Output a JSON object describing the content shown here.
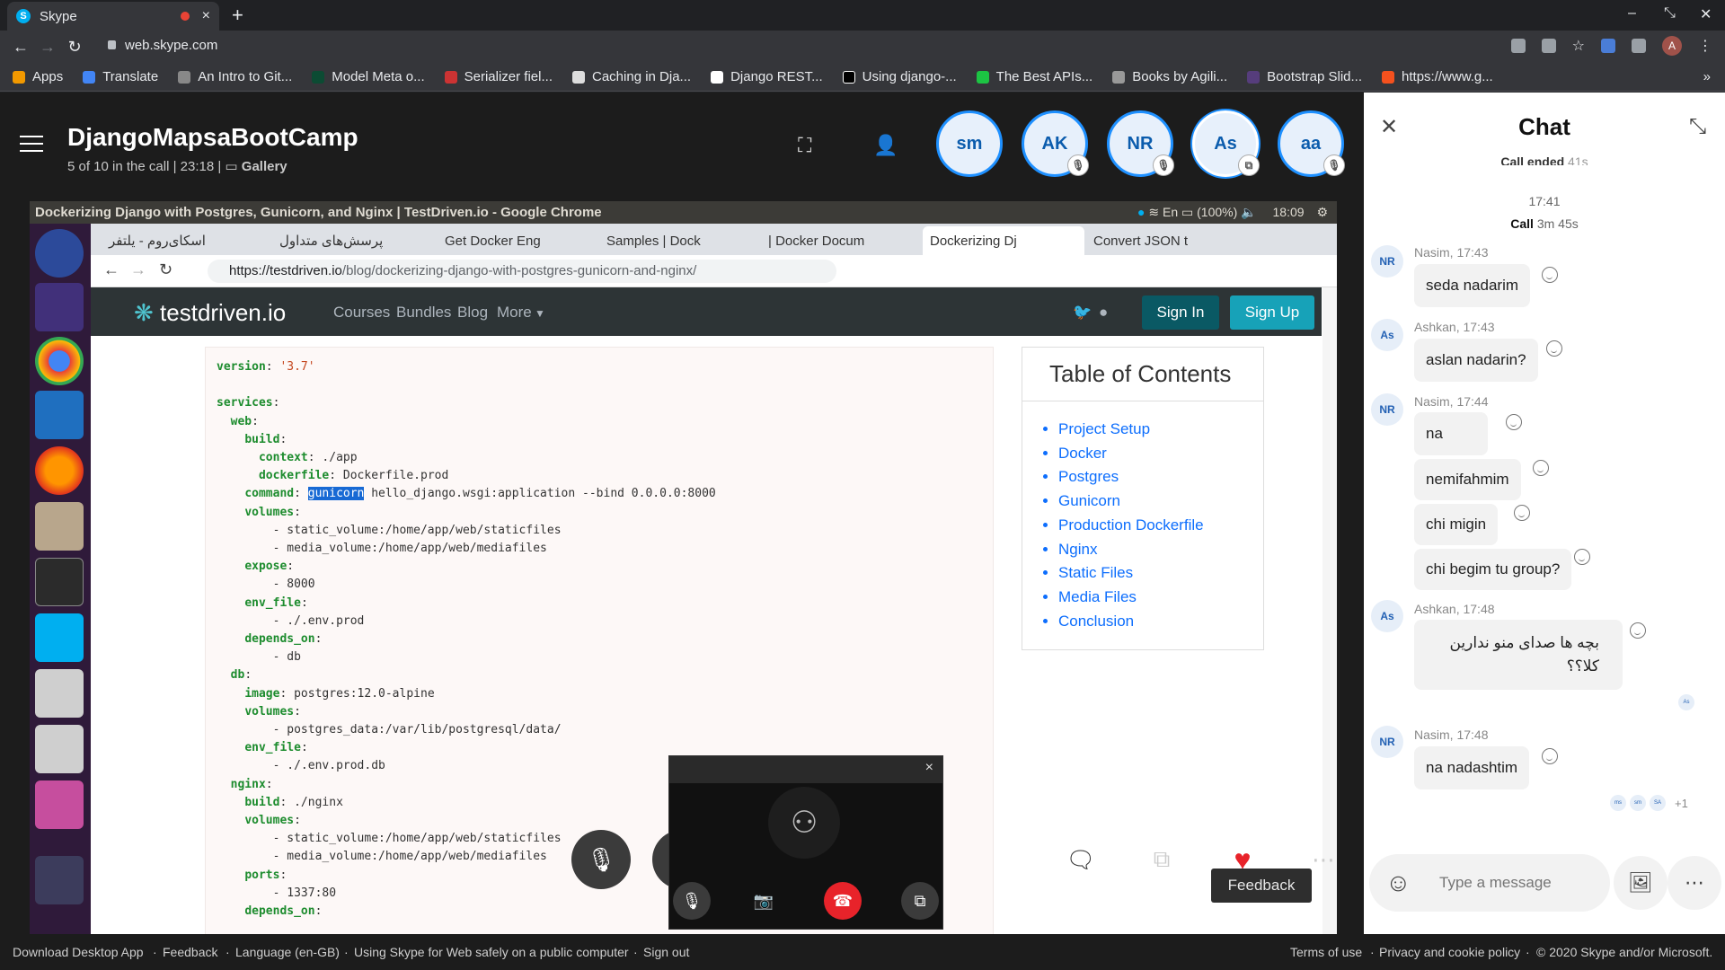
{
  "browser": {
    "tab_title": "Skype",
    "url": "web.skype.com",
    "bookmarks": [
      "Apps",
      "Translate",
      "An Intro to Git...",
      "Model Meta o...",
      "Serializer fiel...",
      "Caching in Dja...",
      "Django REST...",
      "Using django-...",
      "The Best APIs...",
      "Books by Agili...",
      "Bootstrap Slid...",
      "https://www.g..."
    ],
    "profile_initial": "A"
  },
  "call": {
    "title": "DjangoMapsaBootCamp",
    "subtitle": "5 of 10 in the call | 23:18 |",
    "view_mode": "Gallery",
    "participants": [
      "sm",
      "AK",
      "NR",
      "As",
      "aa"
    ],
    "feedback_label": "Feedback"
  },
  "shared_screen": {
    "window_title": "Dockerizing Django with Postgres, Gunicorn, and Nginx | TestDriven.io - Google Chrome",
    "status": {
      "lang": "En",
      "battery": "(100%)",
      "time": "18:09"
    },
    "tabs": [
      "اسکای‌روم - یلتفر",
      "پرسش‌های متداول",
      "Get Docker Eng",
      "Samples | Dock",
      "| Docker Docum",
      "Dockerizing Dj",
      "Convert JSON t"
    ],
    "url_host": "https://testdriven.io",
    "url_path": "/blog/dockerizing-django-with-postgres-gunicorn-and-nginx/",
    "site": {
      "logo": "testdriven.io",
      "nav": [
        "Courses",
        "Bundles",
        "Blog",
        "More"
      ],
      "sign_in": "Sign In",
      "sign_up": "Sign Up"
    },
    "code_lines": [
      {
        "indent": "",
        "key": "version",
        "rest": "",
        "str": "'3.7'"
      },
      {
        "indent": "",
        "key": "",
        "rest": "",
        "str": ""
      },
      {
        "indent": "",
        "key": "services",
        "rest": "",
        "str": ""
      },
      {
        "indent": "  ",
        "key": "web",
        "rest": "",
        "str": ""
      },
      {
        "indent": "    ",
        "key": "build",
        "rest": "",
        "str": ""
      },
      {
        "indent": "      ",
        "key": "context",
        "rest": "./app",
        "str": ""
      },
      {
        "indent": "      ",
        "key": "dockerfile",
        "rest": "Dockerfile.prod",
        "str": ""
      },
      {
        "indent": "    ",
        "key": "command",
        "hl": "gunicorn",
        "rest": "hello_django.wsgi:application --bind 0.0.0.0:8000",
        "str": ""
      },
      {
        "indent": "    ",
        "key": "volumes",
        "rest": "",
        "str": ""
      },
      {
        "indent": "      ",
        "key": "",
        "rest": "- static_volume:/home/app/web/staticfiles",
        "str": ""
      },
      {
        "indent": "      ",
        "key": "",
        "rest": "- media_volume:/home/app/web/mediafiles",
        "str": ""
      },
      {
        "indent": "    ",
        "key": "expose",
        "rest": "",
        "str": ""
      },
      {
        "indent": "      ",
        "key": "",
        "rest": "- 8000",
        "str": ""
      },
      {
        "indent": "    ",
        "key": "env_file",
        "rest": "",
        "str": ""
      },
      {
        "indent": "      ",
        "key": "",
        "rest": "- ./.env.prod",
        "str": ""
      },
      {
        "indent": "    ",
        "key": "depends_on",
        "rest": "",
        "str": ""
      },
      {
        "indent": "      ",
        "key": "",
        "rest": "- db",
        "str": ""
      },
      {
        "indent": "  ",
        "key": "db",
        "rest": "",
        "str": ""
      },
      {
        "indent": "    ",
        "key": "image",
        "rest": "postgres:12.0-alpine",
        "str": ""
      },
      {
        "indent": "    ",
        "key": "volumes",
        "rest": "",
        "str": ""
      },
      {
        "indent": "      ",
        "key": "",
        "rest": "- postgres_data:/var/lib/postgresql/data/",
        "str": ""
      },
      {
        "indent": "    ",
        "key": "env_file",
        "rest": "",
        "str": ""
      },
      {
        "indent": "      ",
        "key": "",
        "rest": "- ./.env.prod.db",
        "str": ""
      },
      {
        "indent": "  ",
        "key": "nginx",
        "rest": "",
        "str": ""
      },
      {
        "indent": "    ",
        "key": "build",
        "rest": "./nginx",
        "str": ""
      },
      {
        "indent": "    ",
        "key": "volumes",
        "rest": "",
        "str": ""
      },
      {
        "indent": "      ",
        "key": "",
        "rest": "- static_volume:/home/app/web/staticfiles",
        "str": ""
      },
      {
        "indent": "      ",
        "key": "",
        "rest": "- media_volume:/home/app/web/mediafiles",
        "str": ""
      },
      {
        "indent": "    ",
        "key": "ports",
        "rest": "",
        "str": ""
      },
      {
        "indent": "      ",
        "key": "",
        "rest": "- 1337:80",
        "str": ""
      },
      {
        "indent": "    ",
        "key": "depends_on",
        "rest": "",
        "str": ""
      }
    ],
    "toc": {
      "title": "Table of Contents",
      "items": [
        "Project Setup",
        "Docker",
        "Postgres",
        "Gunicorn",
        "Production Dockerfile",
        "Nginx",
        "Static Files",
        "Media Files",
        "Conclusion"
      ]
    }
  },
  "chat": {
    "title": "Chat",
    "call_ended_partial": "Call ended",
    "call_ended_time": "41s",
    "time_divider": "17:41",
    "call_label": "Call",
    "call_duration": "3m 45s",
    "messages": [
      {
        "initials": "NR",
        "meta": "Nasim, 17:43",
        "bubbles": [
          "seda nadarim"
        ]
      },
      {
        "initials": "As",
        "meta": "Ashkan, 17:43",
        "bubbles": [
          "aslan nadarin?"
        ]
      },
      {
        "initials": "NR",
        "meta": "Nasim, 17:44",
        "bubbles": [
          "na",
          "nemifahmim",
          "chi migin",
          "chi begim tu group?"
        ]
      },
      {
        "initials": "As",
        "meta": "Ashkan, 17:48",
        "bubbles": [
          "بچه ها صدای منو ندارین\nکلا؟؟"
        ]
      },
      {
        "initials": "NR",
        "meta": "Nasim, 17:48",
        "bubbles": [
          "na nadashtim"
        ]
      }
    ],
    "read_receipts": [
      "ms",
      "sm",
      "SA"
    ],
    "read_extra": "+1",
    "input_placeholder": "Type a message"
  },
  "footer": {
    "left": [
      "Download Desktop App",
      "·",
      "Feedback",
      "·",
      "Language (en-GB)",
      "·",
      "Using Skype for Web safely on a public computer",
      "·",
      "Sign out"
    ],
    "right": [
      "Terms of use",
      "·",
      "Privacy and cookie policy",
      "·",
      "© 2020 Skype and/or Microsoft."
    ]
  }
}
